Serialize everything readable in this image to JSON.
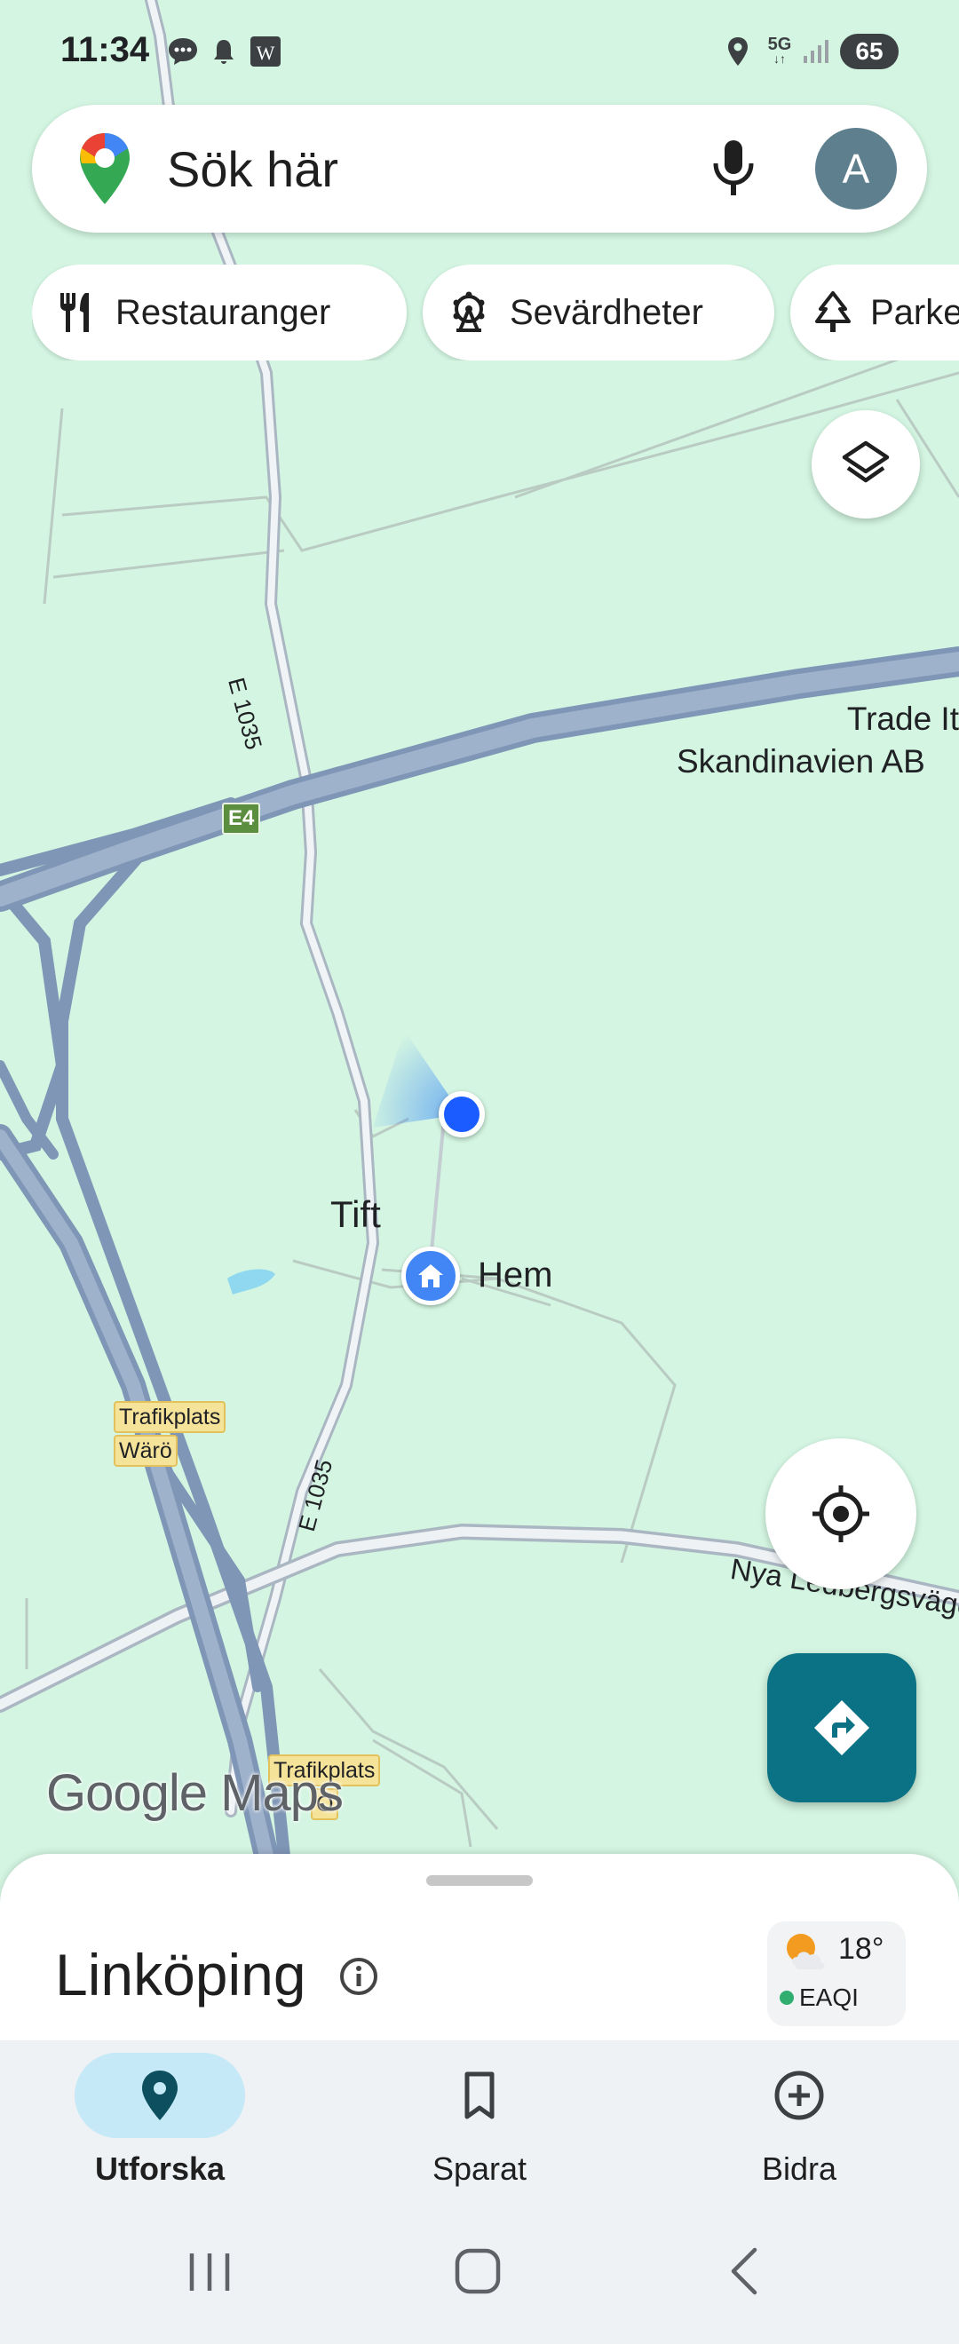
{
  "status_bar": {
    "time": "11:34",
    "battery": "65",
    "icons": [
      "messages-icon",
      "notification-bell-icon",
      "w-app-icon",
      "location-icon",
      "5g-icon",
      "signal-icon"
    ],
    "network_label": "5G"
  },
  "search": {
    "placeholder": "Sök här",
    "avatar_letter": "A"
  },
  "chips": [
    {
      "label": "Restauranger",
      "icon": "fork-knife-icon"
    },
    {
      "label": "Sevärdheter",
      "icon": "ferris-wheel-icon"
    },
    {
      "label": "Parker",
      "icon": "tree-icon"
    }
  ],
  "map": {
    "road_e1035_top": "E 1035",
    "road_e1035_bottom": "E 1035",
    "shield_e4": "E4",
    "poi_trade_line1": "Trade It",
    "poi_trade_line2": "Skandinavien AB",
    "place_tift": "Tift",
    "home_label": "Hem",
    "interchange_waro_line1": "Trafikplats",
    "interchange_waro_line2": "Wärö",
    "interchange_bottom_line1": "Trafikplats",
    "interchange_bottom_line2": "Ö",
    "road_nya": "Nya Ledbergsvägen",
    "watermark": "Google Maps"
  },
  "bottom_sheet": {
    "city": "Linköping",
    "weather_temp": "18°",
    "weather_aqi": "EAQI"
  },
  "nav": [
    {
      "label": "Utforska",
      "icon": "explore-pin-icon",
      "active": true
    },
    {
      "label": "Sparat",
      "icon": "bookmark-icon",
      "active": false
    },
    {
      "label": "Bidra",
      "icon": "plus-circle-icon",
      "active": false
    }
  ],
  "colors": {
    "map_background": "#d3f5e1",
    "highway": "#8aa3c0",
    "minor_road": "#c8ced4",
    "accent_teal": "#0b7285",
    "location_blue": "#1a5cff"
  }
}
